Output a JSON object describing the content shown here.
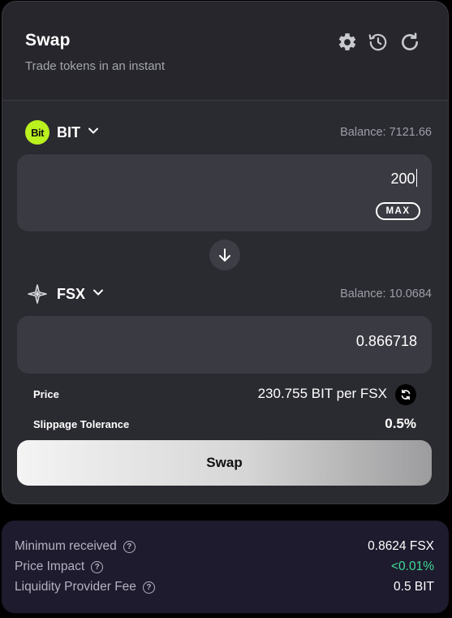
{
  "header": {
    "title": "Swap",
    "subtitle": "Trade tokens in an instant",
    "icons": [
      "gear-icon",
      "history-icon",
      "refresh-icon"
    ]
  },
  "from": {
    "token": "BIT",
    "logo_text": "Bit",
    "balance": "Balance: 7121.66",
    "amount": "200",
    "max_label": "MAX"
  },
  "to": {
    "token": "FSX",
    "balance": "Balance: 10.0684",
    "amount": "0.866718"
  },
  "info": {
    "price_label": "Price",
    "price_value": "230.755 BIT per FSX",
    "slippage_label": "Slippage Tolerance",
    "slippage_value": "0.5%"
  },
  "swap_button": "Swap",
  "details": {
    "rows": [
      {
        "label": "Minimum received",
        "value": "0.8624 FSX"
      },
      {
        "label": "Price Impact",
        "value": "<0.01%"
      },
      {
        "label": "Liquidity Provider Fee",
        "value": "0.5 BIT"
      }
    ],
    "help_glyph": "?"
  },
  "colors": {
    "accent_bit": "#baf11e",
    "price_impact": "#3ddc97",
    "card_bg": "#2a2a31",
    "input_bg": "#3a3a43"
  }
}
